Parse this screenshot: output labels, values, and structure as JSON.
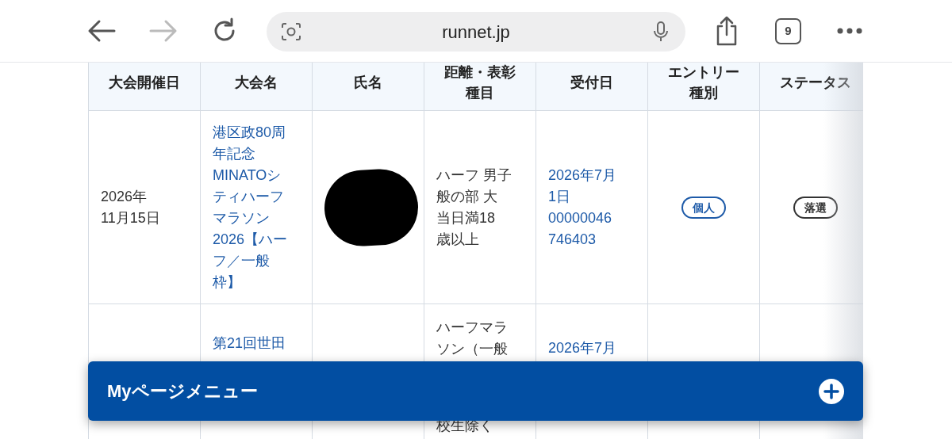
{
  "browser": {
    "url": "runnet.jp",
    "tab_count": "9",
    "forward_disabled": true
  },
  "table": {
    "columns": [
      [
        "大会開催日"
      ],
      [
        "大会名"
      ],
      [
        "氏名"
      ],
      [
        "距離・表彰",
        "種目"
      ],
      [
        "受付日"
      ],
      [
        "エントリー",
        "種別"
      ],
      [
        "ステータス"
      ]
    ],
    "rows": [
      {
        "date": [
          "2026年",
          "11月15日"
        ],
        "event": [
          "港区政80周",
          "年記念",
          "MINATOシ",
          "ティハーフ",
          "マラソン",
          "2026【ハー",
          "フ／一般",
          "枠】"
        ],
        "name_redacted": true,
        "category": [
          "ハーフ 男子",
          "般の部 大",
          "当日満18",
          "歳以上"
        ],
        "received": [
          "2026年7月",
          "1日",
          "00000046",
          "746403"
        ],
        "entry_type": "個人",
        "status": "落選"
      },
      {
        "event": [
          "第21回世田"
        ],
        "category": [
          "ハーフマラ",
          "ソン（一般"
        ],
        "category_tail": [
          "校生除く"
        ],
        "received": [
          "2026年7月"
        ]
      }
    ]
  },
  "menu_bar": {
    "label": "Myページメニュー"
  }
}
